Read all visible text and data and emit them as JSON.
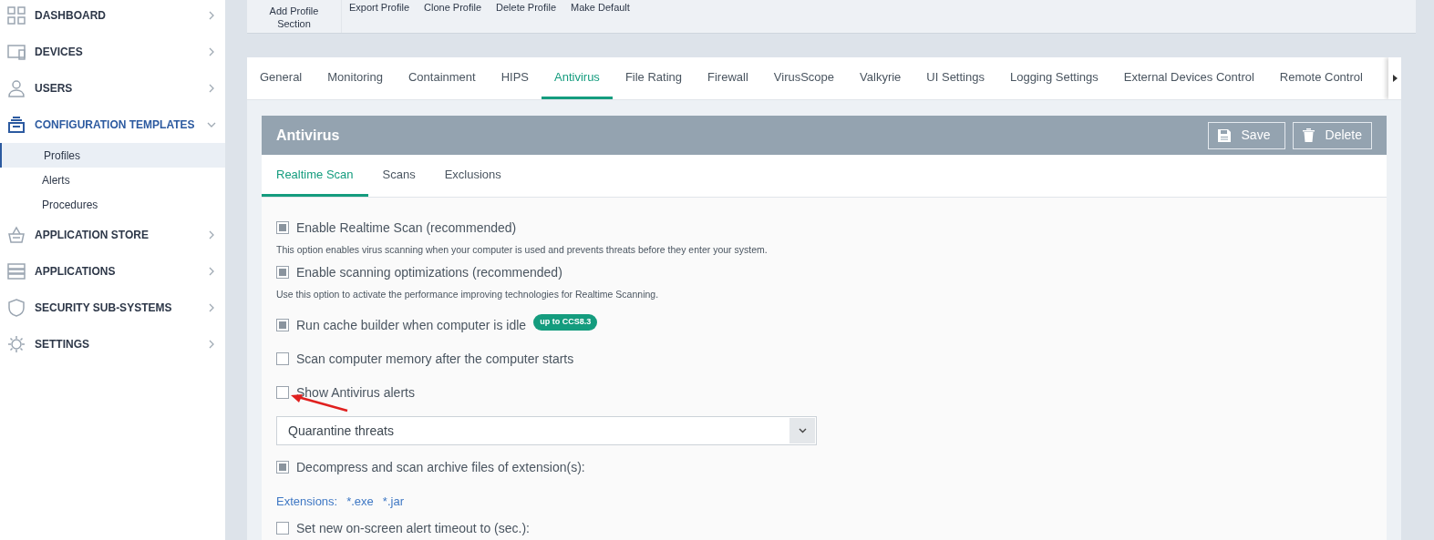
{
  "sidebar": {
    "items": [
      {
        "label": "DASHBOARD",
        "expanded": false
      },
      {
        "label": "DEVICES",
        "expanded": false
      },
      {
        "label": "USERS",
        "expanded": false
      },
      {
        "label": "CONFIGURATION TEMPLATES",
        "expanded": true,
        "children": [
          {
            "label": "Profiles",
            "selected": true
          },
          {
            "label": "Alerts",
            "selected": false
          },
          {
            "label": "Procedures",
            "selected": false
          }
        ]
      },
      {
        "label": "APPLICATION STORE",
        "expanded": false
      },
      {
        "label": "APPLICATIONS",
        "expanded": false
      },
      {
        "label": "SECURITY SUB-SYSTEMS",
        "expanded": false
      },
      {
        "label": "SETTINGS",
        "expanded": false
      }
    ]
  },
  "toolbar": [
    "Add Profile Section",
    "Export Profile",
    "Clone Profile",
    "Delete Profile",
    "Make Default"
  ],
  "tabs": [
    {
      "label": "General",
      "selected": false
    },
    {
      "label": "Monitoring",
      "selected": false
    },
    {
      "label": "Containment",
      "selected": false
    },
    {
      "label": "HIPS",
      "selected": false
    },
    {
      "label": "Antivirus",
      "selected": true
    },
    {
      "label": "File Rating",
      "selected": false
    },
    {
      "label": "Firewall",
      "selected": false
    },
    {
      "label": "VirusScope",
      "selected": false
    },
    {
      "label": "Valkyrie",
      "selected": false
    },
    {
      "label": "UI Settings",
      "selected": false
    },
    {
      "label": "Logging Settings",
      "selected": false
    },
    {
      "label": "External Devices Control",
      "selected": false
    },
    {
      "label": "Remote Control",
      "selected": false
    }
  ],
  "panel": {
    "title": "Antivirus",
    "buttons": [
      {
        "label": "Save"
      },
      {
        "label": "Delete"
      }
    ],
    "subtabs": [
      {
        "label": "Realtime Scan",
        "selected": true
      },
      {
        "label": "Scans",
        "selected": false
      },
      {
        "label": "Exclusions",
        "selected": false
      }
    ],
    "options": [
      {
        "kind": "checkbox",
        "label": "Enable Realtime Scan (recommended)",
        "checked": true,
        "description": "This option enables virus scanning when your computer is used and prevents threats before they enter your system."
      },
      {
        "kind": "checkbox",
        "label": "Enable scanning optimizations (recommended)",
        "checked": true,
        "description": "Use this option to activate the performance improving technologies for Realtime Scanning."
      },
      {
        "kind": "checkbox",
        "label": "Run cache builder when computer is idle",
        "checked": true,
        "badge": "up to CCS8.3"
      },
      {
        "kind": "checkbox",
        "label": "Scan computer memory after the computer starts",
        "checked": false
      },
      {
        "kind": "checkbox",
        "label": "Show Antivirus alerts",
        "checked": false,
        "annotated": true
      },
      {
        "kind": "select",
        "value": "Quarantine threats"
      },
      {
        "kind": "checkbox",
        "label": "Decompress and scan archive files of extension(s):",
        "checked": true
      },
      {
        "kind": "extensions",
        "label": "Extensions:",
        "values": [
          "*.exe",
          "*.jar"
        ]
      },
      {
        "kind": "checkbox",
        "label": "Set new on-screen alert timeout to (sec.):",
        "checked": false
      }
    ]
  }
}
